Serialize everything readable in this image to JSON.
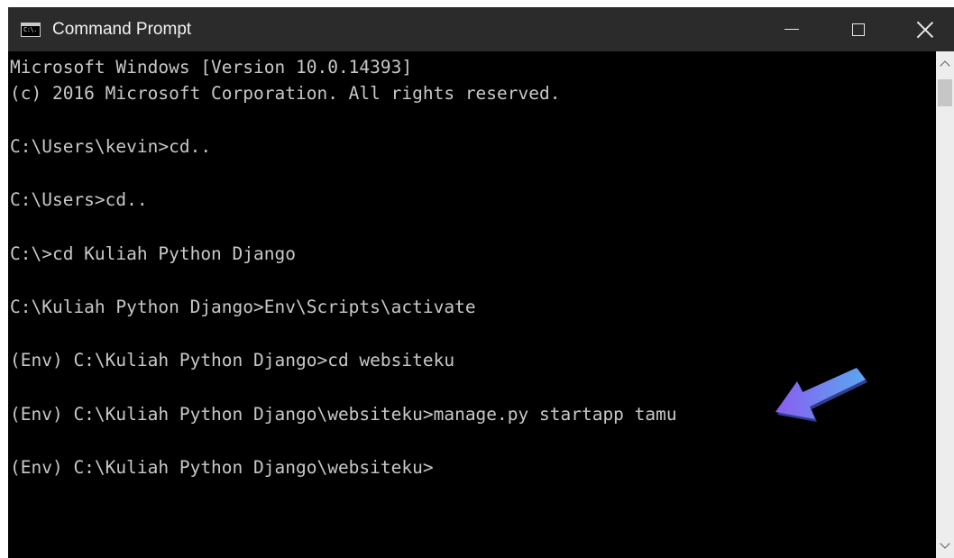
{
  "window": {
    "title": "Command Prompt",
    "icon_name": "cmd-icon",
    "icon_text": "C:\\."
  },
  "controls": {
    "minimize": "minimize-icon",
    "maximize": "maximize-icon",
    "close": "close-icon"
  },
  "console": {
    "lines": [
      "Microsoft Windows [Version 10.0.14393]",
      "(c) 2016 Microsoft Corporation. All rights reserved.",
      "",
      "C:\\Users\\kevin>cd..",
      "",
      "C:\\Users>cd..",
      "",
      "C:\\>cd Kuliah Python Django",
      "",
      "C:\\Kuliah Python Django>Env\\Scripts\\activate",
      "",
      "(Env) C:\\Kuliah Python Django>cd websiteku",
      "",
      "(Env) C:\\Kuliah Python Django\\websiteku>manage.py startapp tamu",
      "",
      "(Env) C:\\Kuliah Python Django\\websiteku>"
    ]
  },
  "colors": {
    "titlebar": "#2b2b2b",
    "console_bg": "#000000",
    "console_text": "#c8c8c8",
    "arrow": "#7b6cf0"
  },
  "annotation": {
    "icon_name": "pointer-arrow-icon"
  }
}
